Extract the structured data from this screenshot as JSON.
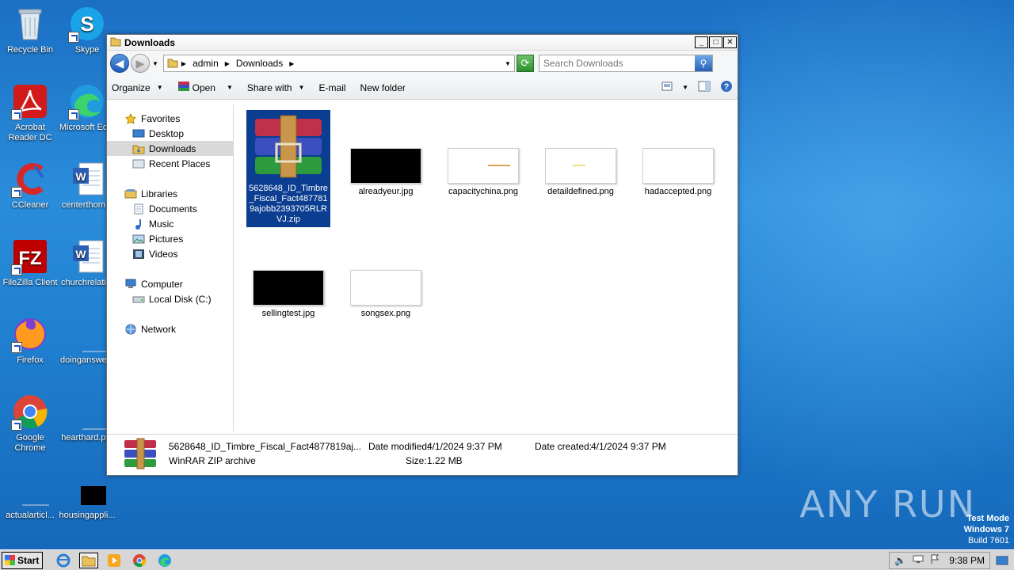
{
  "desktop": {
    "icons": [
      {
        "label": "Recycle Bin"
      },
      {
        "label": "Skype"
      },
      {
        "label": "Acrobat Reader DC"
      },
      {
        "label": "Microsoft Ed..."
      },
      {
        "label": "CCleaner"
      },
      {
        "label": "centerthom..."
      },
      {
        "label": "FileZilla Client"
      },
      {
        "label": "churchrelati..."
      },
      {
        "label": "Firefox"
      },
      {
        "label": "doinganswe..."
      },
      {
        "label": "Google Chrome"
      },
      {
        "label": "hearthard.p..."
      },
      {
        "label": "actualarticl..."
      },
      {
        "label": "housingappli..."
      }
    ]
  },
  "window": {
    "title": "Downloads",
    "address": {
      "seg1": "admin",
      "seg2": "Downloads"
    },
    "search_placeholder": "Search Downloads",
    "toolbar": {
      "organize": "Organize",
      "open": "Open",
      "share": "Share with",
      "email": "E-mail",
      "new_folder": "New folder"
    },
    "nav": {
      "favorites": "Favorites",
      "desktop": "Desktop",
      "downloads": "Downloads",
      "recent": "Recent Places",
      "libraries": "Libraries",
      "documents": "Documents",
      "music": "Music",
      "pictures": "Pictures",
      "videos": "Videos",
      "computer": "Computer",
      "local_disk": "Local Disk (C:)",
      "network": "Network"
    },
    "files": [
      {
        "name": "5628648_ID_Timbre_Fiscal_Fact4877819ajobb2393705RLRVJ.zip"
      },
      {
        "name": "alreadyeur.jpg"
      },
      {
        "name": "capacitychina.png"
      },
      {
        "name": "detaildefined.png"
      },
      {
        "name": "hadaccepted.png"
      },
      {
        "name": "sellingtest.jpg"
      },
      {
        "name": "songsex.png"
      }
    ],
    "details": {
      "name": "5628648_ID_Timbre_Fiscal_Fact4877819aj...",
      "type": "WinRAR ZIP archive",
      "modified_label": "Date modified:",
      "modified": "4/1/2024 9:37 PM",
      "created_label": "Date created:",
      "created": "4/1/2024 9:37 PM",
      "size_label": "Size:",
      "size": "1.22 MB"
    }
  },
  "taskbar": {
    "start": "Start",
    "time": "9:38 PM"
  },
  "watermark": {
    "text": "ANY RUN",
    "test_mode": "Test Mode",
    "os": "Windows 7",
    "build": "Build 7601"
  }
}
